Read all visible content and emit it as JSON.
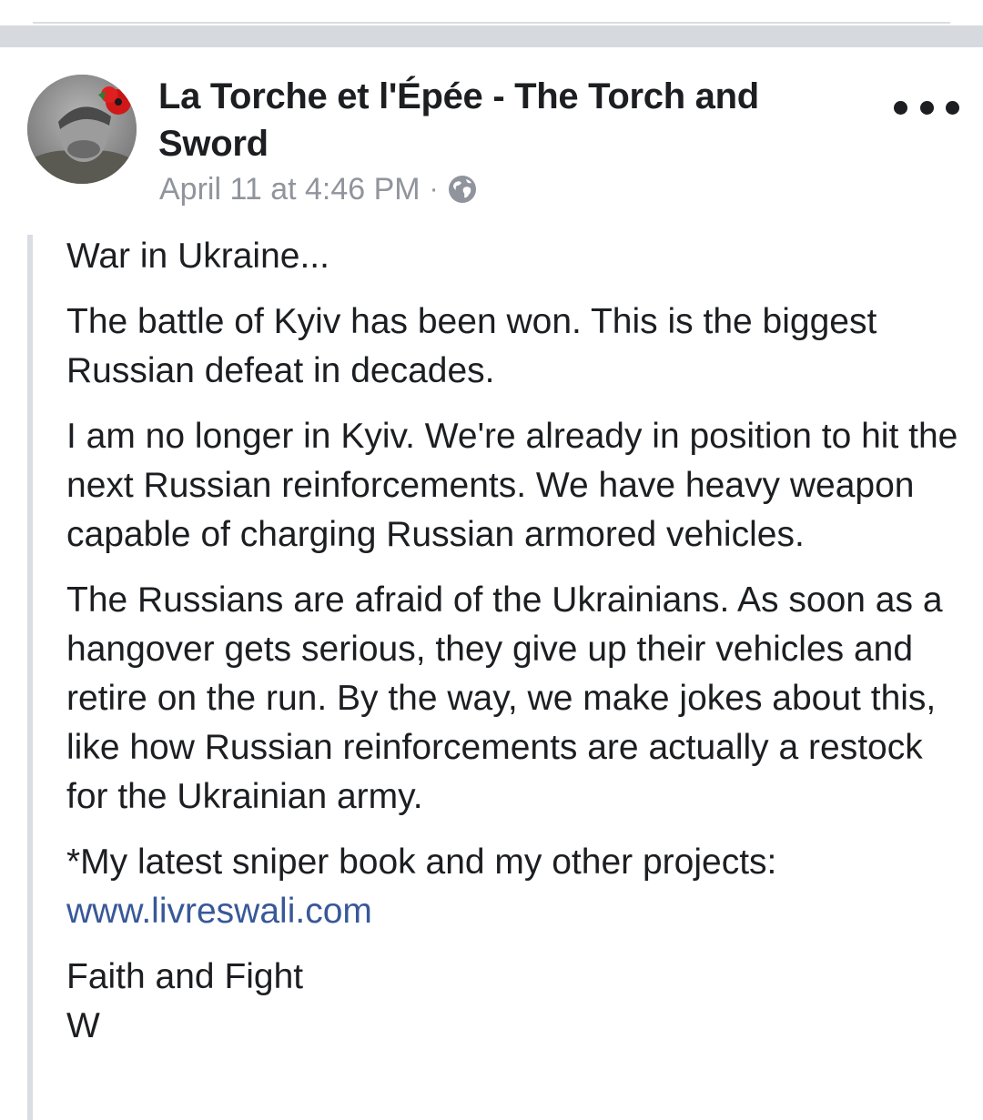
{
  "post": {
    "author": "La Torche et l'Épée - The Torch and Sword",
    "timestamp": "April 11 at 4:46 PM",
    "separator": "·",
    "privacy_icon": "globe-icon",
    "more_icon": "more-options-icon",
    "content": {
      "p1": "War in Ukraine...",
      "p2": "The battle of Kyiv has been won. This is the biggest Russian defeat in decades.",
      "p3": "I am no longer in Kyiv. We're already in position to hit the next Russian reinforcements. We have heavy weapon capable of charging Russian armored vehicles.",
      "p4": "The Russians are afraid of the Ukrainians. As soon as a hangover gets serious, they give up their vehicles and retire on the run. By the way, we make jokes about this, like how Russian reinforcements are actually a restock for the Ukrainian army.",
      "p5_text": "*My latest sniper book and my other projects:",
      "p5_link": "www.livreswali.com",
      "signoff_line1": "Faith and Fight",
      "signoff_line2": "W"
    }
  },
  "colors": {
    "text": "#1c1e21",
    "meta": "#90949c",
    "link": "#385898",
    "separator": "#d6d9dd",
    "quote_bar": "#dadde1"
  }
}
